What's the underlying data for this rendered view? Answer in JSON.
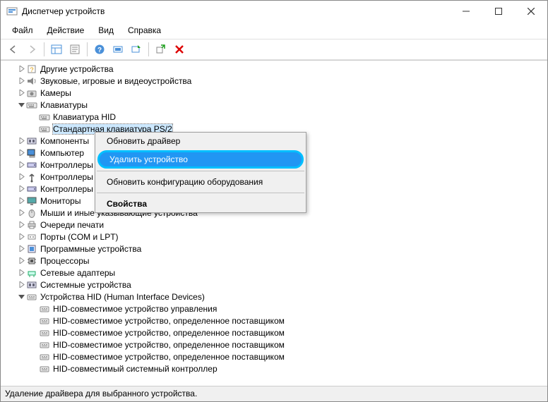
{
  "window": {
    "title": "Диспетчер устройств",
    "app_icon": "device-manager-icon"
  },
  "menubar": {
    "file": "Файл",
    "action": "Действие",
    "view": "Вид",
    "help": "Справка"
  },
  "toolbar": {
    "back": "back-arrow",
    "forward": "forward-arrow",
    "details_pane": "details-pane",
    "properties": "properties",
    "help": "help",
    "scan": "scan-hardware",
    "enable": "enable",
    "update": "update-driver",
    "uninstall": "uninstall"
  },
  "tree": [
    {
      "id": "other",
      "icon": "device-other-icon",
      "toggle": "▷",
      "label": "Другие устройства"
    },
    {
      "id": "audio",
      "icon": "device-audio-icon",
      "toggle": "▷",
      "label": "Звуковые, игровые и видеоустройства"
    },
    {
      "id": "cameras",
      "icon": "device-camera-icon",
      "toggle": "▷",
      "label": "Камеры"
    },
    {
      "id": "keyboards",
      "icon": "device-keyboard-icon",
      "toggle": "▽",
      "label": "Клавиатуры",
      "expanded": true,
      "children": [
        {
          "id": "kb-hid",
          "icon": "device-keyboard-icon",
          "label": "Клавиатура HID"
        },
        {
          "id": "kb-ps2",
          "icon": "device-keyboard-icon",
          "label": "Стандартная клавиатура PS/2",
          "selected": true
        }
      ]
    },
    {
      "id": "components",
      "icon": "device-system-icon",
      "toggle": "▷",
      "label": "Компоненты"
    },
    {
      "id": "computer",
      "icon": "device-computer-icon",
      "toggle": "▷",
      "label": "Компьютер"
    },
    {
      "id": "ide",
      "icon": "device-storage-controller-icon",
      "toggle": "▷",
      "label": "Контроллеры"
    },
    {
      "id": "usb",
      "icon": "device-usb-icon",
      "toggle": "▷",
      "label": "Контроллеры"
    },
    {
      "id": "storage-ctrl",
      "icon": "device-storage-controller-icon",
      "toggle": "▷",
      "label": "Контроллеры"
    },
    {
      "id": "monitors",
      "icon": "device-monitor-icon",
      "toggle": "▷",
      "label": "Мониторы"
    },
    {
      "id": "mice",
      "icon": "device-mouse-icon",
      "toggle": "▷",
      "label": "Мыши и иные указывающие устройства"
    },
    {
      "id": "print-queues",
      "icon": "device-printer-icon",
      "toggle": "▷",
      "label": "Очереди печати"
    },
    {
      "id": "ports",
      "icon": "device-port-icon",
      "toggle": "▷",
      "label": "Порты (COM и LPT)"
    },
    {
      "id": "software-devices",
      "icon": "device-software-icon",
      "toggle": "▷",
      "label": "Программные устройства"
    },
    {
      "id": "processors",
      "icon": "device-processor-icon",
      "toggle": "▷",
      "label": "Процессоры"
    },
    {
      "id": "network",
      "icon": "device-network-icon",
      "toggle": "▷",
      "label": "Сетевые адаптеры"
    },
    {
      "id": "system",
      "icon": "device-system-icon",
      "toggle": "▷",
      "label": "Системные устройства"
    },
    {
      "id": "hid",
      "icon": "device-hid-icon",
      "toggle": "▽",
      "label": "Устройства HID (Human Interface Devices)",
      "expanded": true,
      "children": [
        {
          "id": "hid1",
          "icon": "device-hid-icon",
          "label": "HID-совместимое устройство управления"
        },
        {
          "id": "hid2",
          "icon": "device-hid-icon",
          "label": "HID-совместимое устройство, определенное поставщиком"
        },
        {
          "id": "hid3",
          "icon": "device-hid-icon",
          "label": "HID-совместимое устройство, определенное поставщиком"
        },
        {
          "id": "hid4",
          "icon": "device-hid-icon",
          "label": "HID-совместимое устройство, определенное поставщиком"
        },
        {
          "id": "hid5",
          "icon": "device-hid-icon",
          "label": "HID-совместимое устройство, определенное поставщиком"
        },
        {
          "id": "hid6",
          "icon": "device-hid-icon",
          "label": "HID-совместимый системный контроллер"
        }
      ]
    }
  ],
  "context_menu": {
    "update_driver": "Обновить драйвер",
    "uninstall": "Удалить устройство",
    "scan": "Обновить конфигурацию оборудования",
    "properties": "Свойства"
  },
  "statusbar": {
    "text": "Удаление драйвера для выбранного устройства."
  },
  "colors": {
    "highlight_bg": "#2196f3",
    "highlight_border": "#00bfff",
    "selection_bg": "#cce8ff"
  }
}
